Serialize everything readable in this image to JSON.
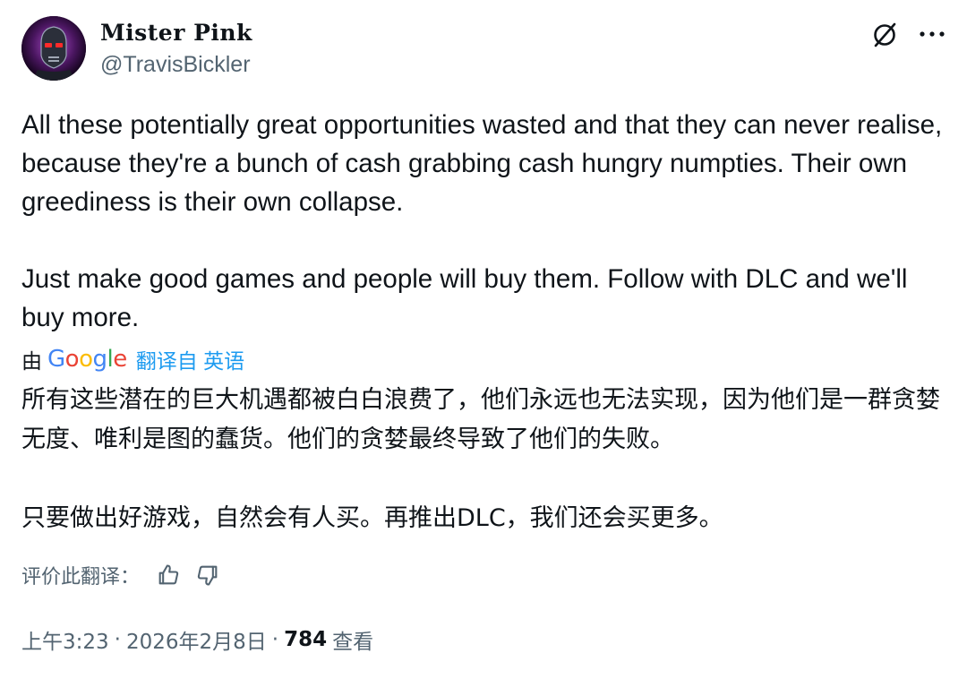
{
  "author": {
    "display_name": "Mister Pink",
    "handle": "@TravisBickler",
    "avatar_icon": "terminator-skull-avatar"
  },
  "actions": {
    "grok_icon": "grok-icon",
    "more_icon": "more-icon"
  },
  "tweet": {
    "paragraphs": [
      "All these potentially great opportunities wasted and that they can never realise, because they're a bunch of cash grabbing cash hungry numpties. Their own greediness is their own collapse.",
      "Just make good games and people will buy them. Follow with DLC and we'll buy more."
    ]
  },
  "translation": {
    "by_label": "由",
    "logo_letters": [
      "G",
      "o",
      "o",
      "g",
      "l",
      "e"
    ],
    "link_text": "翻译自 英语",
    "paragraphs": [
      "所有这些潜在的巨大机遇都被白白浪费了，他们永远也无法实现，因为他们是一群贪婪无度、唯利是图的蠢货。他们的贪婪最终导致了他们的失败。",
      "只要做出好游戏，自然会有人买。再推出DLC，我们还会买更多。"
    ],
    "rate_label": "评价此翻译：",
    "thumbs_up_icon": "thumbs-up-icon",
    "thumbs_down_icon": "thumbs-down-icon"
  },
  "meta": {
    "time": "上午3:23",
    "date": "2026年2月8日",
    "separator": "·",
    "views_count": "784",
    "views_label": "查看"
  },
  "colors": {
    "text_primary": "#0f1419",
    "text_secondary": "#536471",
    "link": "#1d9bf0"
  }
}
